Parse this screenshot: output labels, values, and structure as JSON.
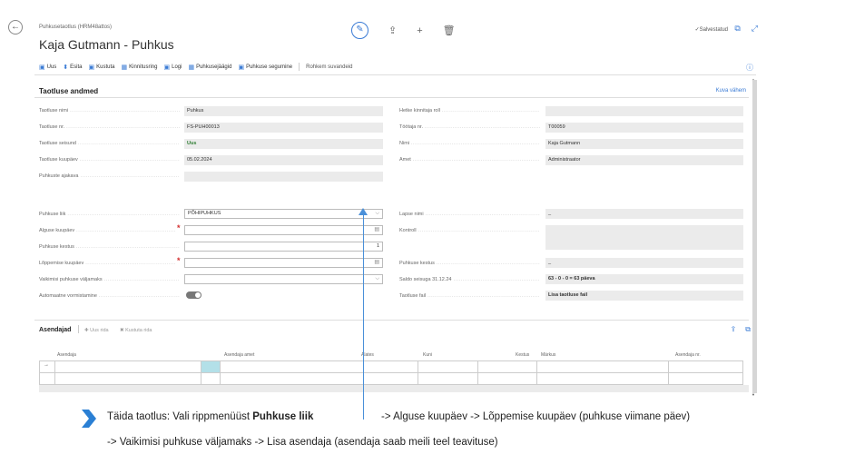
{
  "header": {
    "breadcrumb": "Puhkusetaotlus (HRM48attos)",
    "title": "Kaja Gutmann - Puhkus",
    "saved": "✓Salvestatud"
  },
  "toolbar": {
    "items": [
      "Uus",
      "Esita",
      "Kustuta",
      "Kinnitusring",
      "Logi",
      "Puhkusejäägid",
      "Puhkuse segumine"
    ],
    "more": "Rohkem suvandeid"
  },
  "section": {
    "title": "Taotluse andmed",
    "show_less": "Kuva vähem"
  },
  "left_fields": [
    {
      "label": "Taotluse nimi",
      "value": "Puhkus"
    },
    {
      "label": "Taotluse nr.",
      "value": "FS-PUH00013"
    },
    {
      "label": "Taotluse seisund",
      "value": "Uus"
    },
    {
      "label": "Taotluse kuupäev",
      "value": "05.02.2024"
    },
    {
      "label": "Puhkuste ajakava",
      "value": ""
    }
  ],
  "right_fields": [
    {
      "label": "Hetke kinnitaja roll",
      "value": ""
    },
    {
      "label": "Töötaja nr.",
      "value": "T00059"
    },
    {
      "label": "Nimi",
      "value": "Kaja Gutmann"
    },
    {
      "label": "Amet",
      "value": "Administraator"
    }
  ],
  "form_left": {
    "leave_type_label": "Puhkuse liik",
    "leave_type_value": "PÕHIPUHKUS",
    "start_label": "Alguse kuupäev",
    "duration_label": "Puhkuse kestus",
    "duration_value": "1",
    "end_label": "Lõppemise kuupäev",
    "payout_label": "Vaikimisi puhkuse väljamaks",
    "autoform_label": "Automaatne vormistamine"
  },
  "form_right": {
    "child_label": "Lapse nimi",
    "child_value": "_",
    "control_label": "Kontroll",
    "duration_label": "Puhkuse kestus",
    "duration_value": "_",
    "balance_label": "Saldo seisuga 31.12.24",
    "balance_value": "63 - 0 - 0 = 63 päeva",
    "file_label": "Taotluse fail",
    "file_value": "Lisa taotluse fail"
  },
  "substitutes": {
    "title": "Asendajad",
    "new_row": "Uus rida",
    "delete_row": "Kustuta rida",
    "columns": [
      "Asendaja",
      "Asendaja amet",
      "Alates",
      "Kuni",
      "Kestus",
      "Märkus",
      "Asendaja nr."
    ]
  },
  "instructions": {
    "line1_a": "Täida taotlus: Vali rippmenüüst ",
    "line1_b": "Puhkuse liik",
    "line1_c": "-> Alguse kuupäev -> Lõppemise kuupäev (puhkuse viimane päev)",
    "line2": "-> Vaikimisi puhkuse väljamaks ->  Lisa asendaja (asendaja saab meili teel teavituse)"
  }
}
